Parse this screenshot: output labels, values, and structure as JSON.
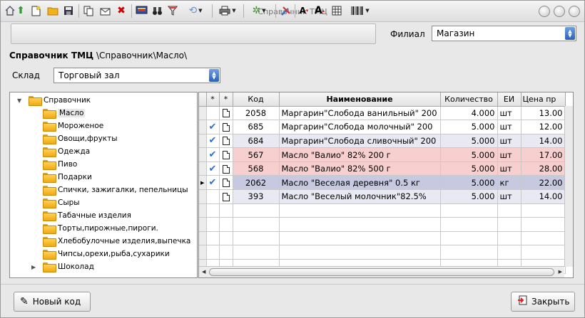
{
  "window": {
    "title": "Справочник ТМЦ"
  },
  "toolbar": {
    "icons": [
      "arrow-up-icon",
      "new-document-icon",
      "open-folder-icon",
      "save-disk-icon",
      "copy-icon",
      "envelope-icon",
      "delete-icon",
      "monitor-icon",
      "binoculars-icon",
      "filter-icon",
      "refresh-icon",
      "printer-icon",
      "settings-icon",
      "tools-icon",
      "font-decrease-icon",
      "font-increase-icon",
      "grid-view-icon",
      "barcode-icon"
    ]
  },
  "branch": {
    "label": "Филиал",
    "value": "Магазин"
  },
  "header": {
    "title": "Справочник ТМЦ",
    "path": " \\Справочник\\Масло\\"
  },
  "warehouse": {
    "label": "Склад",
    "value": "Торговый зал"
  },
  "tree": {
    "root": "Справочник",
    "items": [
      "Масло",
      "Мороженое",
      "Овощи,фрукты",
      "Одежда",
      "Пиво",
      "Подарки",
      "Спички, зажигалки, пепельницы",
      "Сыры",
      "Табачные изделия",
      "Торты,пирожные,пироги.",
      "Хлебобулочные изделия,выпечка",
      "Чипсы,орехи,рыба,сухарики",
      "Шоколад"
    ],
    "selected": "Масло"
  },
  "grid": {
    "columns": [
      "*",
      "*",
      "Код",
      "Наименование",
      "Количество",
      "ЕИ",
      "Цена пр"
    ],
    "rows": [
      {
        "code": "2058",
        "name": "Маргарин\"Слобода ванильный\" 200",
        "qty": "4.000",
        "unit": "шт",
        "price": "13.00",
        "checked": false,
        "current": false,
        "bg": "#ffffff"
      },
      {
        "code": "685",
        "name": "Маргарин\"Слобода молочный\" 200",
        "qty": "5.000",
        "unit": "шт",
        "price": "12.00",
        "checked": true,
        "current": false,
        "bg": "#ffffff"
      },
      {
        "code": "684",
        "name": "Маргарин\"Слобода сливочный\" 200",
        "qty": "5.000",
        "unit": "шт",
        "price": "14.00",
        "checked": true,
        "current": false,
        "bg": "#e9e9f3"
      },
      {
        "code": "567",
        "name": "Масло \"Валио\" 82% 200 г",
        "qty": "5.000",
        "unit": "шт",
        "price": "17.00",
        "checked": true,
        "current": false,
        "bg": "#f8cfcf"
      },
      {
        "code": "568",
        "name": "Масло \"Валио\" 82% 500 г",
        "qty": "5.000",
        "unit": "шт",
        "price": "28.00",
        "checked": true,
        "current": false,
        "bg": "#f8cfcf"
      },
      {
        "code": "2062",
        "name": "Масло \"Веселая деревня\" 0.5 кг",
        "qty": "5.000",
        "unit": "кг",
        "price": "22.00",
        "checked": true,
        "current": true,
        "bg": "#c7c9e0"
      },
      {
        "code": "393",
        "name": "Масло \"Веселый молочник\"82.5%",
        "qty": "5.000",
        "unit": "шт",
        "price": "14.00",
        "checked": false,
        "current": false,
        "bg": "#e9e9f3"
      }
    ]
  },
  "buttons": {
    "new_code": "Новый код",
    "close": "Закрыть"
  }
}
